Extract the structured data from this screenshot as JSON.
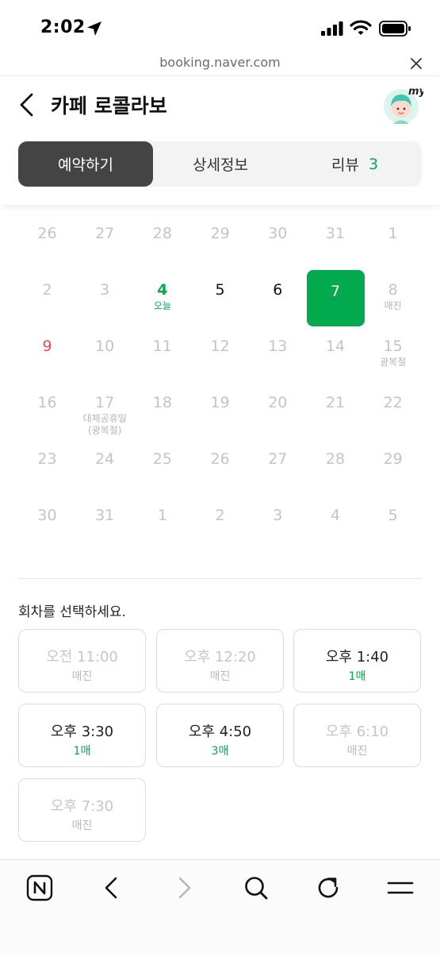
{
  "status_bar": {
    "time": "2:02"
  },
  "url_bar": {
    "url": "booking.naver.com"
  },
  "header": {
    "title": "카페 로콜라보",
    "avatar_label": "my",
    "tabs": [
      {
        "label": "예약하기",
        "active": true
      },
      {
        "label": "상세정보",
        "active": false
      },
      {
        "label": "리뷰",
        "count": "3",
        "active": false
      }
    ]
  },
  "calendar": {
    "weeks": [
      [
        {
          "d": "26"
        },
        {
          "d": "27"
        },
        {
          "d": "28"
        },
        {
          "d": "29"
        },
        {
          "d": "30"
        },
        {
          "d": "31"
        },
        {
          "d": "1"
        }
      ],
      [
        {
          "d": "2"
        },
        {
          "d": "3"
        },
        {
          "d": "4",
          "sub": "오늘",
          "state": "today"
        },
        {
          "d": "5",
          "state": "available"
        },
        {
          "d": "6",
          "state": "available"
        },
        {
          "d": "7",
          "state": "selected"
        },
        {
          "d": "8",
          "sub": "매진"
        }
      ],
      [
        {
          "d": "9",
          "state": "holiday"
        },
        {
          "d": "10"
        },
        {
          "d": "11"
        },
        {
          "d": "12"
        },
        {
          "d": "13"
        },
        {
          "d": "14"
        },
        {
          "d": "15",
          "sub": "광복절"
        }
      ],
      [
        {
          "d": "16"
        },
        {
          "d": "17",
          "sub": "대체공휴일",
          "sub2": "(광복절)"
        },
        {
          "d": "18"
        },
        {
          "d": "19"
        },
        {
          "d": "20"
        },
        {
          "d": "21"
        },
        {
          "d": "22"
        }
      ],
      [
        {
          "d": "23"
        },
        {
          "d": "24"
        },
        {
          "d": "25"
        },
        {
          "d": "26"
        },
        {
          "d": "27"
        },
        {
          "d": "28"
        },
        {
          "d": "29"
        }
      ],
      [
        {
          "d": "30"
        },
        {
          "d": "31"
        },
        {
          "d": "1"
        },
        {
          "d": "2"
        },
        {
          "d": "3"
        },
        {
          "d": "4"
        },
        {
          "d": "5"
        }
      ]
    ]
  },
  "slots_section": {
    "title": "회차를 선택하세요.",
    "slots": [
      {
        "time": "오전 11:00",
        "status": "매진",
        "sold_out": true
      },
      {
        "time": "오후 12:20",
        "status": "매진",
        "sold_out": true
      },
      {
        "time": "오후 1:40",
        "status": "1매",
        "sold_out": false
      },
      {
        "time": "오후 3:30",
        "status": "1매",
        "sold_out": false
      },
      {
        "time": "오후 4:50",
        "status": "3매",
        "sold_out": false
      },
      {
        "time": "오후 6:10",
        "status": "매진",
        "sold_out": true
      },
      {
        "time": "오후 7:30",
        "status": "매진",
        "sold_out": true
      }
    ]
  },
  "toolbar": {
    "icons": [
      "naver-home-icon",
      "back-arrow-icon",
      "forward-arrow-icon",
      "search-icon",
      "refresh-icon",
      "menu-icon"
    ]
  },
  "colors": {
    "accent": "#03a94d",
    "holiday": "#ef4a52",
    "tab_active": "#444444"
  }
}
